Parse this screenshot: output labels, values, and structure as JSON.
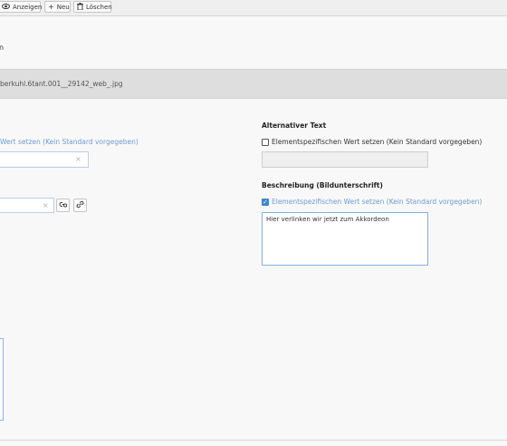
{
  "toolbar": {
    "view_label": "Anzeigen",
    "new_label": "Neu",
    "delete_label": "Löschen"
  },
  "header": {
    "title_fragment": "n"
  },
  "file": {
    "name": "berkuhl.6tant.001__29142_web_.jpg"
  },
  "left": {
    "override_link": "Wert setzen (Kein Standard vorgegeben)",
    "input1_value": "",
    "input2_value": ""
  },
  "alt_text": {
    "label": "Alternativer Text",
    "checkbox_label": "Elementspezifischen Wert setzen (Kein Standard vorgegeben)",
    "checked": false,
    "value": ""
  },
  "description": {
    "label": "Beschreibung (Bildunterschrift)",
    "checkbox_label": "Elementspezifischen Wert setzen (Kein Standard vorgegeben)",
    "checked": true,
    "value": "Hier verlinken wir jetzt zum Akkordeon"
  },
  "icons": {
    "view": "eye-icon",
    "new": "plus-icon",
    "delete": "trash-icon",
    "clear": "close-icon",
    "link_browser": "link-browser-icon",
    "link": "link-icon",
    "check": "checkmark-icon"
  },
  "colors": {
    "accent": "#3a88d4",
    "link": "#6d9cd2",
    "input_focus": "#7fb0e3"
  }
}
